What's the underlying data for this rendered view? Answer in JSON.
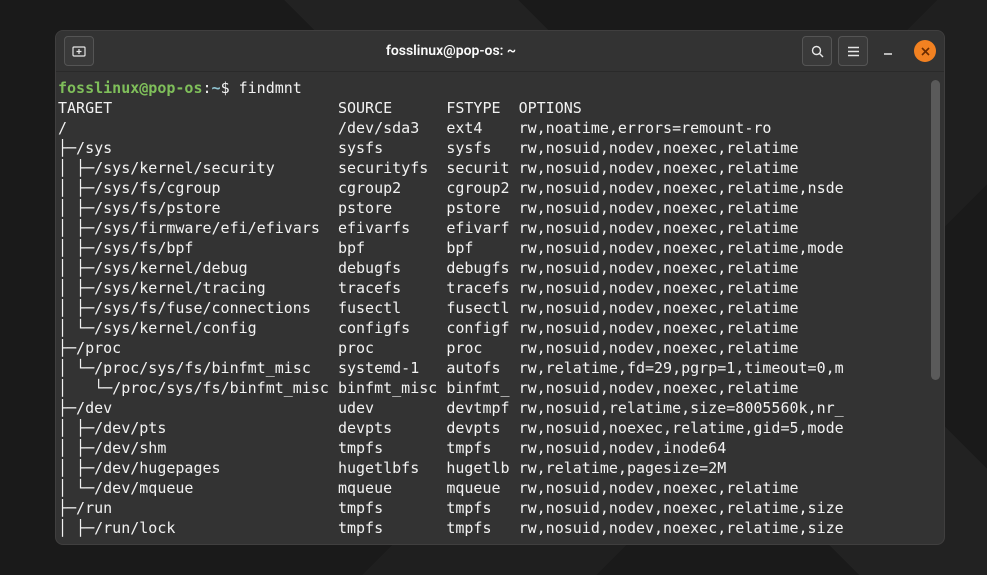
{
  "window": {
    "title": "fosslinux@pop-os: ~"
  },
  "prompt": {
    "user_host": "fosslinux@pop-os",
    "sep": ":",
    "path": "~",
    "dollar": "$",
    "command": " findmnt"
  },
  "cols": [
    "TARGET",
    "SOURCE",
    "FSTYPE",
    "OPTIONS"
  ],
  "rows": [
    [
      "/",
      "",
      "/dev/sda3",
      "ext4",
      "rw,noatime,errors=remount-ro"
    ],
    [
      "├─/sys",
      "",
      "sysfs",
      "sysfs",
      "rw,nosuid,nodev,noexec,relatime"
    ],
    [
      "│ ├─/sys/kernel/security",
      "",
      "securityfs",
      "securit",
      "rw,nosuid,nodev,noexec,relatime"
    ],
    [
      "│ ├─/sys/fs/cgroup",
      "",
      "cgroup2",
      "cgroup2",
      "rw,nosuid,nodev,noexec,relatime,nsde"
    ],
    [
      "│ ├─/sys/fs/pstore",
      "",
      "pstore",
      "pstore",
      "rw,nosuid,nodev,noexec,relatime"
    ],
    [
      "│ ├─/sys/firmware/efi/efivars",
      "",
      "efivarfs",
      "efivarf",
      "rw,nosuid,nodev,noexec,relatime"
    ],
    [
      "│ ├─/sys/fs/bpf",
      "",
      "bpf",
      "bpf",
      "rw,nosuid,nodev,noexec,relatime,mode"
    ],
    [
      "│ ├─/sys/kernel/debug",
      "",
      "debugfs",
      "debugfs",
      "rw,nosuid,nodev,noexec,relatime"
    ],
    [
      "│ ├─/sys/kernel/tracing",
      "",
      "tracefs",
      "tracefs",
      "rw,nosuid,nodev,noexec,relatime"
    ],
    [
      "│ ├─/sys/fs/fuse/connections",
      "",
      "fusectl",
      "fusectl",
      "rw,nosuid,nodev,noexec,relatime"
    ],
    [
      "│ └─/sys/kernel/config",
      "",
      "configfs",
      "configf",
      "rw,nosuid,nodev,noexec,relatime"
    ],
    [
      "├─/proc",
      "",
      "proc",
      "proc",
      "rw,nosuid,nodev,noexec,relatime"
    ],
    [
      "│ └─/proc/sys/fs/binfmt_misc",
      "",
      "systemd-1",
      "autofs",
      "rw,relatime,fd=29,pgrp=1,timeout=0,m"
    ],
    [
      "│   └─/proc/sys/fs/binfmt_misc",
      "",
      "binfmt_misc",
      "binfmt_",
      "rw,nosuid,nodev,noexec,relatime"
    ],
    [
      "├─/dev",
      "",
      "udev",
      "devtmpf",
      "rw,nosuid,relatime,size=8005560k,nr_"
    ],
    [
      "│ ├─/dev/pts",
      "",
      "devpts",
      "devpts",
      "rw,nosuid,noexec,relatime,gid=5,mode"
    ],
    [
      "│ ├─/dev/shm",
      "",
      "tmpfs",
      "tmpfs",
      "rw,nosuid,nodev,inode64"
    ],
    [
      "│ ├─/dev/hugepages",
      "",
      "hugetlbfs",
      "hugetlb",
      "rw,relatime,pagesize=2M"
    ],
    [
      "│ └─/dev/mqueue",
      "",
      "mqueue",
      "mqueue",
      "rw,nosuid,nodev,noexec,relatime"
    ],
    [
      "├─/run",
      "",
      "tmpfs",
      "tmpfs",
      "rw,nosuid,nodev,noexec,relatime,size"
    ],
    [
      "│ ├─/run/lock",
      "",
      "tmpfs",
      "tmpfs",
      "rw,nosuid,nodev,noexec,relatime,size"
    ]
  ]
}
